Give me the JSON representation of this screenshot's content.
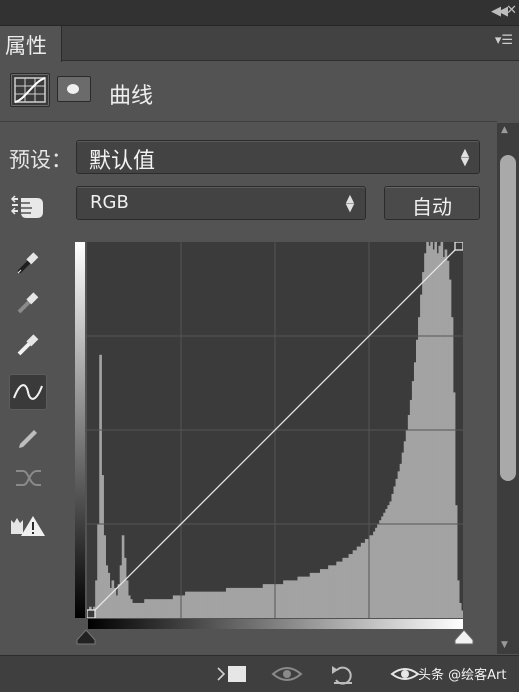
{
  "panel": {
    "tab_label": "属性",
    "title": "曲线",
    "preset_label": "预设：",
    "preset_value": "默认值",
    "channel_value": "RGB",
    "auto_button": "自动"
  },
  "watermark": "头条 @绘客Art",
  "curve": {
    "points": [
      [
        0,
        0
      ],
      [
        255,
        255
      ]
    ],
    "histogram_color": "#a3a3a3",
    "curve_color": "#e6e6e6"
  },
  "histogram": [
    2,
    3,
    2,
    3,
    10,
    25,
    70,
    38,
    22,
    14,
    12,
    8,
    10,
    8,
    6,
    9,
    14,
    22,
    16,
    10,
    6,
    5,
    4,
    4,
    4,
    4,
    4,
    4,
    5,
    5,
    5,
    5,
    5,
    5,
    5,
    5,
    5,
    5,
    5,
    5,
    5,
    5,
    6,
    6,
    6,
    6,
    6,
    6,
    7,
    7,
    7,
    7,
    7,
    7,
    7,
    7,
    7,
    7,
    7,
    7,
    7,
    7,
    7,
    7,
    7,
    7,
    7,
    7,
    8,
    8,
    8,
    8,
    8,
    8,
    8,
    8,
    8,
    8,
    8,
    8,
    8,
    8,
    8,
    8,
    8,
    8,
    9,
    9,
    9,
    9,
    9,
    9,
    9,
    9,
    9,
    9,
    10,
    10,
    10,
    10,
    10,
    10,
    10,
    11,
    11,
    11,
    11,
    11,
    11,
    12,
    12,
    12,
    12,
    12,
    13,
    13,
    13,
    13,
    14,
    14,
    14,
    14,
    15,
    15,
    15,
    16,
    16,
    16,
    17,
    17,
    18,
    18,
    19,
    19,
    20,
    20,
    21,
    21,
    22,
    22,
    23,
    24,
    25,
    26,
    27,
    28,
    29,
    30,
    31,
    33,
    35,
    37,
    39,
    41,
    44,
    47,
    50,
    54,
    58,
    63,
    68,
    74,
    80,
    86,
    92,
    97,
    100,
    99,
    100,
    98,
    100,
    97,
    99,
    100,
    96,
    98,
    95,
    90,
    80,
    60,
    30,
    10,
    4,
    2
  ]
}
